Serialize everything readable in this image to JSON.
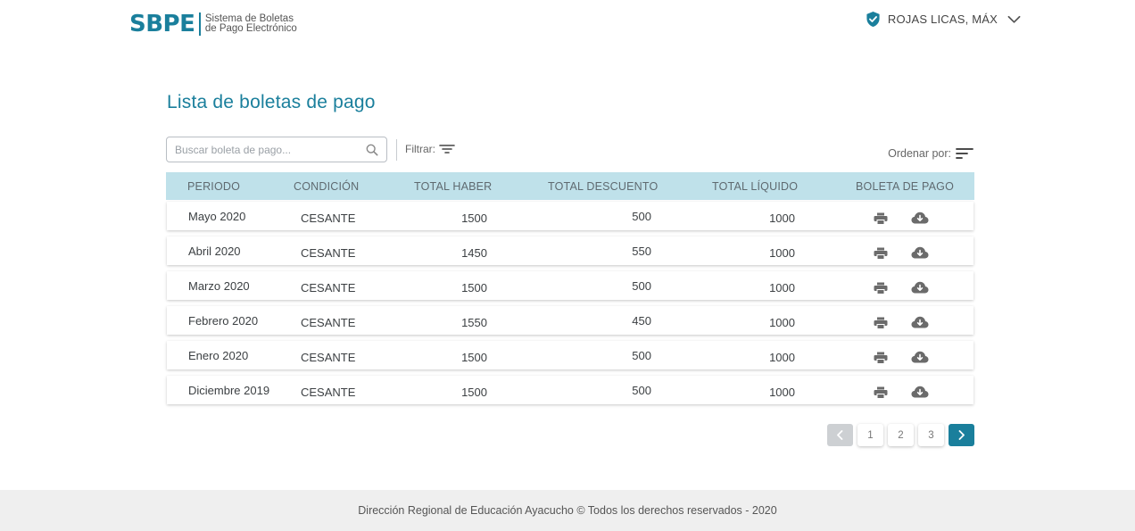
{
  "header": {
    "logo": "SBPE",
    "subtitle_line1": "Sistema de Boletas",
    "subtitle_line2": "de Pago Electrónico",
    "user_name": "ROJAS LICAS, MÁX",
    "user_icon": "shield-check-icon",
    "menu_icon": "chevron-down-icon"
  },
  "page": {
    "title": "Lista de boletas de pago"
  },
  "toolbar": {
    "search_placeholder": "Buscar boleta de pago...",
    "search_icon": "search-icon",
    "filter_label": "Filtrar:",
    "filter_icon": "filter-icon",
    "sort_label": "Ordenar por:",
    "sort_icon": "sort-icon"
  },
  "table": {
    "columns": [
      "PERIODO",
      "CONDICIÓN",
      "TOTAL HABER",
      "TOTAL DESCUENTO",
      "TOTAL LÍQUIDO",
      "BOLETA DE PAGO"
    ],
    "rows": [
      {
        "periodo": "Mayo 2020",
        "condicion": "CESANTE",
        "haber": "1500",
        "descuento": "500",
        "liquido": "1000"
      },
      {
        "periodo": "Abril 2020",
        "condicion": "CESANTE",
        "haber": "1450",
        "descuento": "550",
        "liquido": "1000"
      },
      {
        "periodo": "Marzo 2020",
        "condicion": "CESANTE",
        "haber": "1500",
        "descuento": "500",
        "liquido": "1000"
      },
      {
        "periodo": "Febrero 2020",
        "condicion": "CESANTE",
        "haber": "1550",
        "descuento": "450",
        "liquido": "1000"
      },
      {
        "periodo": "Enero 2020",
        "condicion": "CESANTE",
        "haber": "1500",
        "descuento": "500",
        "liquido": "1000"
      },
      {
        "periodo": "Diciembre 2019",
        "condicion": "CESANTE",
        "haber": "1500",
        "descuento": "500",
        "liquido": "1000"
      }
    ],
    "action_icons": [
      "print-icon",
      "cloud-download-icon"
    ]
  },
  "pagination": {
    "pages": [
      "1",
      "2",
      "3"
    ],
    "prev_icon": "chevron-left-icon",
    "next_icon": "chevron-right-icon"
  },
  "footer": {
    "text": "Dirección Regional de Educación Ayacucho © Todos los derechos reservados - 2020"
  },
  "colors": {
    "brand": "#1a7f9c",
    "table_header_bg": "#bfe1ea",
    "footer_bg": "#efefef",
    "icon_gray": "#666666",
    "pager_prev_bg": "#cdd0d3"
  }
}
